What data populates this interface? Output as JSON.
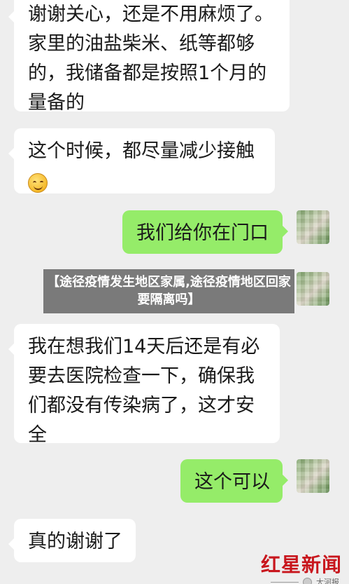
{
  "messages": [
    {
      "sender": "contact",
      "text": "谢谢关心，还是不用麻烦了。家里的油盐柴米、纸等都够的，我储备都是按照1个月的量备的"
    },
    {
      "sender": "contact",
      "text": "这个时候，都尽量减少接触",
      "emoji": "smile-emoji"
    },
    {
      "sender": "self",
      "text": "我们给你在门口"
    },
    {
      "sender": "self",
      "text": ""
    },
    {
      "sender": "contact",
      "text": "我在想我们14天后还是有必要去医院检查一下，确保我们都没有传染病了，这才安全"
    },
    {
      "sender": "self",
      "text": "这个可以"
    },
    {
      "sender": "contact",
      "text": "真的谢谢了"
    }
  ],
  "caption_banner": "【途径疫情发生地区家属,途径疫情地区回家要隔离吗】",
  "watermark": {
    "brand": "红星新闻",
    "source": "大河报"
  },
  "colors": {
    "background": "#eeeeee",
    "incoming_bubble": "#ffffff",
    "outgoing_bubble": "#95ec69",
    "brand_red": "#c8161d"
  }
}
